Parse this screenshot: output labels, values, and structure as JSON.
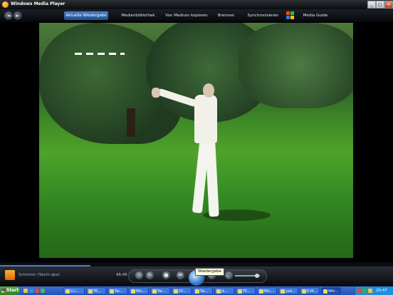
{
  "window": {
    "title": "Windows Media Player"
  },
  "titlebar_buttons": {
    "minimize": "_",
    "maximize": "□",
    "close": "✕"
  },
  "nav": {
    "back": "◄",
    "forward": "►"
  },
  "tabs": [
    {
      "label": "Aktuelle Wiedergabe"
    },
    {
      "label": "Medienbibliothek"
    },
    {
      "label": "Von Medium kopieren"
    },
    {
      "label": "Brennen"
    },
    {
      "label": "Synchronisieren"
    },
    {
      "label": "Media Guide"
    }
  ],
  "status": {
    "text": "Schrimm (Taichi qbe)",
    "time": "45:45"
  },
  "player": {
    "tooltip": "Wiedergabe",
    "progress_fraction": 0.23,
    "volume_fraction": 0.8
  },
  "taskbar": {
    "start_label": "Start",
    "items": [
      {
        "label": "G:\\..."
      },
      {
        "label": "TE..."
      },
      {
        "label": "Tai..."
      },
      {
        "label": "Mic..."
      },
      {
        "label": "Tai..."
      },
      {
        "label": "ST..."
      },
      {
        "label": "Tai..."
      },
      {
        "label": "Jk..."
      },
      {
        "label": "TE..."
      },
      {
        "label": "Mic..."
      },
      {
        "label": "yzd..."
      },
      {
        "label": "E-M..."
      },
      {
        "label": "Win..."
      }
    ],
    "clock": "20:47"
  }
}
